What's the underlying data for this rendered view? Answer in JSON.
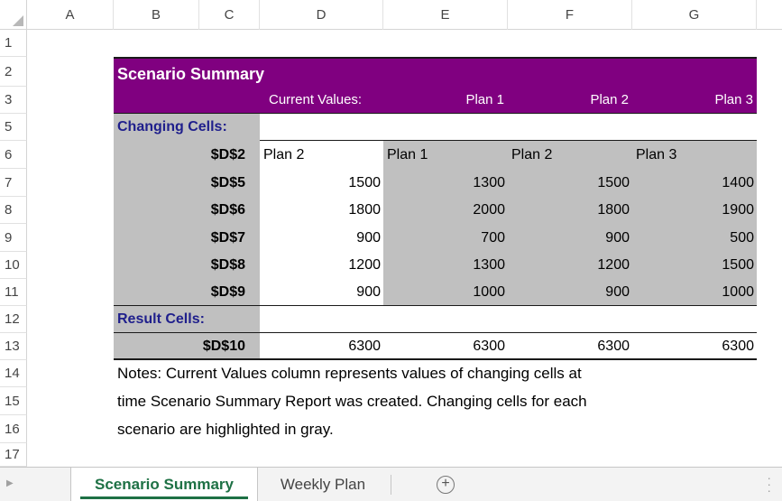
{
  "columns": [
    "A",
    "B",
    "C",
    "D",
    "E",
    "F",
    "G"
  ],
  "rows": [
    "1",
    "2",
    "3",
    "5",
    "6",
    "7",
    "8",
    "9",
    "10",
    "11",
    "12",
    "13",
    "14",
    "15",
    "16",
    "17"
  ],
  "report": {
    "title": "Scenario Summary",
    "current_values_label": "Current Values:",
    "plans": [
      "Plan 1",
      "Plan 2",
      "Plan 3"
    ],
    "changing_cells_label": "Changing Cells:",
    "changing": [
      {
        "ref": "$D$2",
        "current": "Plan 2",
        "plan1": "Plan 1",
        "plan2": "Plan 2",
        "plan3": "Plan 3"
      },
      {
        "ref": "$D$5",
        "current": "1500",
        "plan1": "1300",
        "plan2": "1500",
        "plan3": "1400"
      },
      {
        "ref": "$D$6",
        "current": "1800",
        "plan1": "2000",
        "plan2": "1800",
        "plan3": "1900"
      },
      {
        "ref": "$D$7",
        "current": "900",
        "plan1": "700",
        "plan2": "900",
        "plan3": "500"
      },
      {
        "ref": "$D$8",
        "current": "1200",
        "plan1": "1300",
        "plan2": "1200",
        "plan3": "1500"
      },
      {
        "ref": "$D$9",
        "current": "900",
        "plan1": "1000",
        "plan2": "900",
        "plan3": "1000"
      }
    ],
    "result_cells_label": "Result Cells:",
    "result": {
      "ref": "$D$10",
      "current": "6300",
      "plan1": "6300",
      "plan2": "6300",
      "plan3": "6300"
    },
    "notes": [
      "Notes:  Current Values column represents values of changing cells at",
      "time Scenario Summary Report was created.  Changing cells for each",
      "scenario are highlighted in gray."
    ]
  },
  "sheet_tabs": {
    "active": "Scenario Summary",
    "other": "Weekly Plan",
    "add_icon": "plus-circle-icon"
  },
  "colors": {
    "header_fill": "#800080",
    "changing_fill": "#c0c0c0",
    "section_text": "#1f1f8c",
    "active_tab": "#1e7145"
  }
}
